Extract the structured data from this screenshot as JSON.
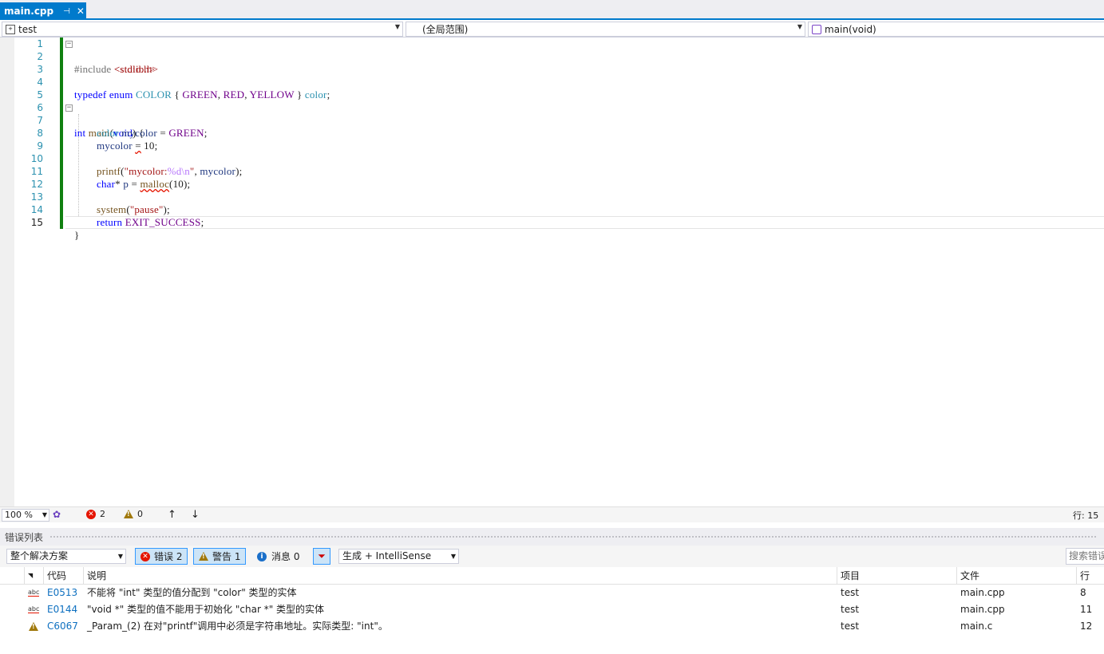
{
  "tab": {
    "title": "main.cpp",
    "pin_icon": "pin-icon",
    "close_icon": "close-icon"
  },
  "navbar": {
    "project": "test",
    "scope": "(全局范围)",
    "member": "main(void)"
  },
  "editor": {
    "line_numbers": [
      "1",
      "2",
      "3",
      "4",
      "5",
      "6",
      "7",
      "8",
      "9",
      "10",
      "11",
      "12",
      "13",
      "14",
      "15"
    ],
    "current_line": 15
  },
  "editor_status": {
    "zoom": "100 %",
    "errors": "2",
    "warnings": "0",
    "up": "↑",
    "down": "↓",
    "line": "行: 15"
  },
  "panel": {
    "title": "错误列表",
    "scope_filter": "整个解决方案",
    "errors_btn": "错误 2",
    "warnings_btn": "警告 1",
    "messages_btn": "消息 0",
    "build_filter": "生成 + IntelliSense",
    "search_placeholder": "搜索错误列表"
  },
  "table": {
    "headers": {
      "code": "代码",
      "desc": "说明",
      "project": "项目",
      "file": "文件",
      "line": "行"
    },
    "rows": [
      {
        "kind": "abc",
        "code": "E0513",
        "desc": "不能将 \"int\" 类型的值分配到 \"color\" 类型的实体",
        "project": "test",
        "file": "main.cpp",
        "line": "8"
      },
      {
        "kind": "abc",
        "code": "E0144",
        "desc": "\"void *\" 类型的值不能用于初始化 \"char *\" 类型的实体",
        "project": "test",
        "file": "main.cpp",
        "line": "11"
      },
      {
        "kind": "warn",
        "code": "C6067",
        "desc": "_Param_(2) 在对\"printf\"调用中必须是字符串地址。实际类型: \"int\"。",
        "project": "test",
        "file": "main.c",
        "line": "12"
      }
    ]
  },
  "colors": {
    "accent": "#007acc",
    "error": "#e51400",
    "warning": "#a0780a",
    "info": "#1a6fc9",
    "changebar": "#108010"
  }
}
